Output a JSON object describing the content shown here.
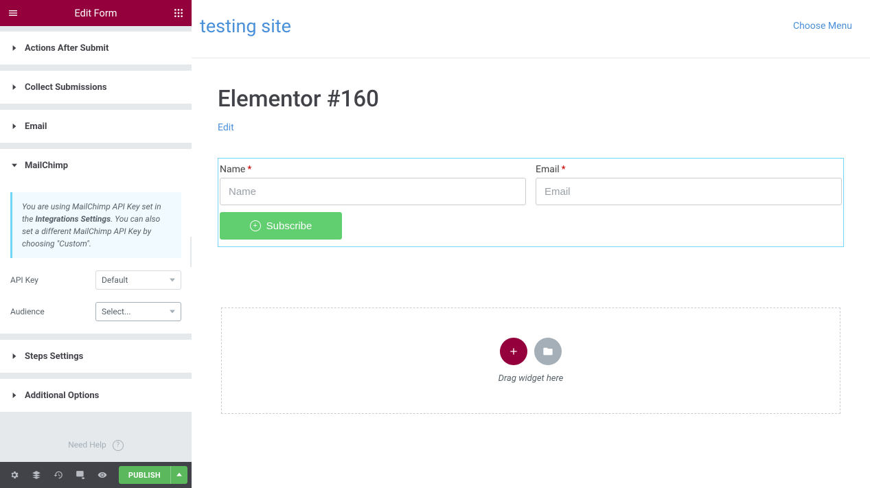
{
  "sidebar": {
    "title": "Edit Form",
    "sections": {
      "actions_after_submit": "Actions After Submit",
      "collect_submissions": "Collect Submissions",
      "email": "Email",
      "mailchimp": "MailChimp",
      "steps_settings": "Steps Settings",
      "additional_options": "Additional Options"
    },
    "mailchimp": {
      "info_pre": "You are using MailChimp API Key set in the ",
      "info_bold": "Integrations Settings",
      "info_post": ". You can also set a different MailChimp API Key by choosing \"Custom\".",
      "api_key_label": "API Key",
      "api_key_value": "Default",
      "audience_label": "Audience",
      "audience_value": "Select..."
    },
    "help_label": "Need Help",
    "publish_label": "PUBLISH"
  },
  "canvas": {
    "site_title": "testing site",
    "choose_menu": "Choose Menu",
    "page_title": "Elementor #160",
    "edit_link": "Edit",
    "form": {
      "name_label": "Name",
      "name_placeholder": "Name",
      "email_label": "Email",
      "email_placeholder": "Email",
      "subscribe_label": "Subscribe"
    },
    "dropzone": {
      "hint": "Drag widget here"
    }
  }
}
